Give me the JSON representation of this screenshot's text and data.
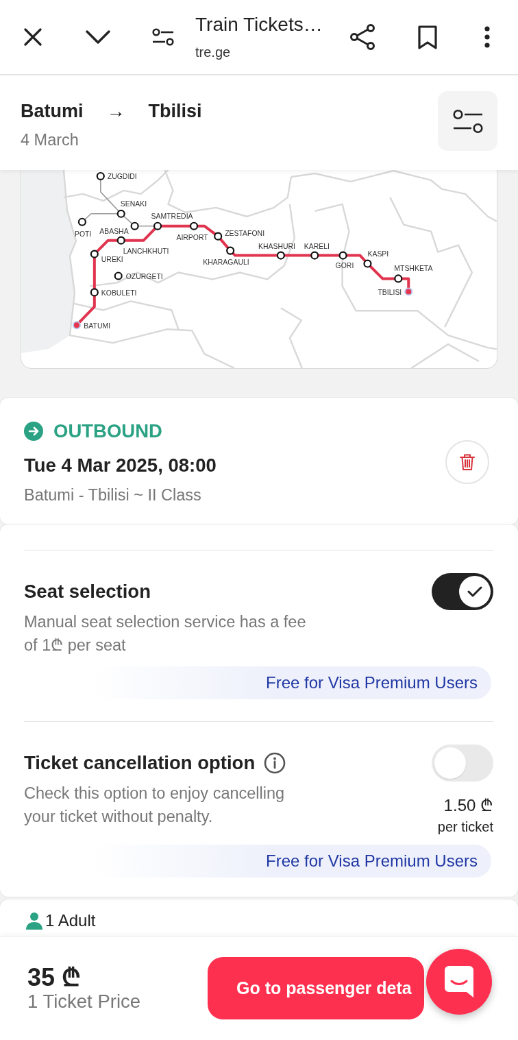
{
  "browser_bar": {
    "title": "Train Tickets…",
    "url": "tre.ge"
  },
  "route_header": {
    "from": "Batumi",
    "arrow": "→",
    "to": "Tbilisi",
    "date": "4 March"
  },
  "map": {
    "stations": [
      {
        "name": "ZUGDIDI",
        "kind": "stop"
      },
      {
        "name": "SENAKI",
        "kind": "stop"
      },
      {
        "name": "POTI",
        "kind": "stop"
      },
      {
        "name": "ABASHA",
        "kind": "stop"
      },
      {
        "name": "SAMTREDIA",
        "kind": "stop"
      },
      {
        "name": "AIRPORT",
        "kind": "stop"
      },
      {
        "name": "ZESTAFONI",
        "kind": "stop"
      },
      {
        "name": "KHARAGAULI",
        "kind": "stop"
      },
      {
        "name": "KHASHURI",
        "kind": "stop"
      },
      {
        "name": "KARELI",
        "kind": "stop"
      },
      {
        "name": "GORI",
        "kind": "stop"
      },
      {
        "name": "KASPI",
        "kind": "stop"
      },
      {
        "name": "MTSHKETA",
        "kind": "stop"
      },
      {
        "name": "TBILISI",
        "kind": "terminal"
      },
      {
        "name": "LANCHKHUTI",
        "kind": "stop"
      },
      {
        "name": "UREKI",
        "kind": "stop"
      },
      {
        "name": "OZURGETI",
        "kind": "stop"
      },
      {
        "name": "KOBULETI",
        "kind": "stop"
      },
      {
        "name": "BATUMI",
        "kind": "terminal"
      }
    ]
  },
  "journey": {
    "direction": "OUTBOUND",
    "datetime": "Tue 4 Mar 2025, 08:00",
    "details": "Batumi - Tbilisi ~ II Class"
  },
  "options": [
    {
      "title": "Seat selection",
      "info": false,
      "description": "Manual seat selection service has a fee of 1₾ per seat",
      "checked": true,
      "offer": "Free for Visa Premium Users"
    },
    {
      "title": "Ticket cancellation option",
      "info": true,
      "description": "Check this option to enjoy cancelling your ticket without penalty.",
      "checked": false,
      "price": "1.50 ₾",
      "price_unit": "per ticket",
      "offer": "Free for Visa Premium Users"
    }
  ],
  "passengers": {
    "label": "1 Adult"
  },
  "footer": {
    "price": "35 ₾",
    "price_label": "1 Ticket Price",
    "button": "Go to passenger deta"
  }
}
